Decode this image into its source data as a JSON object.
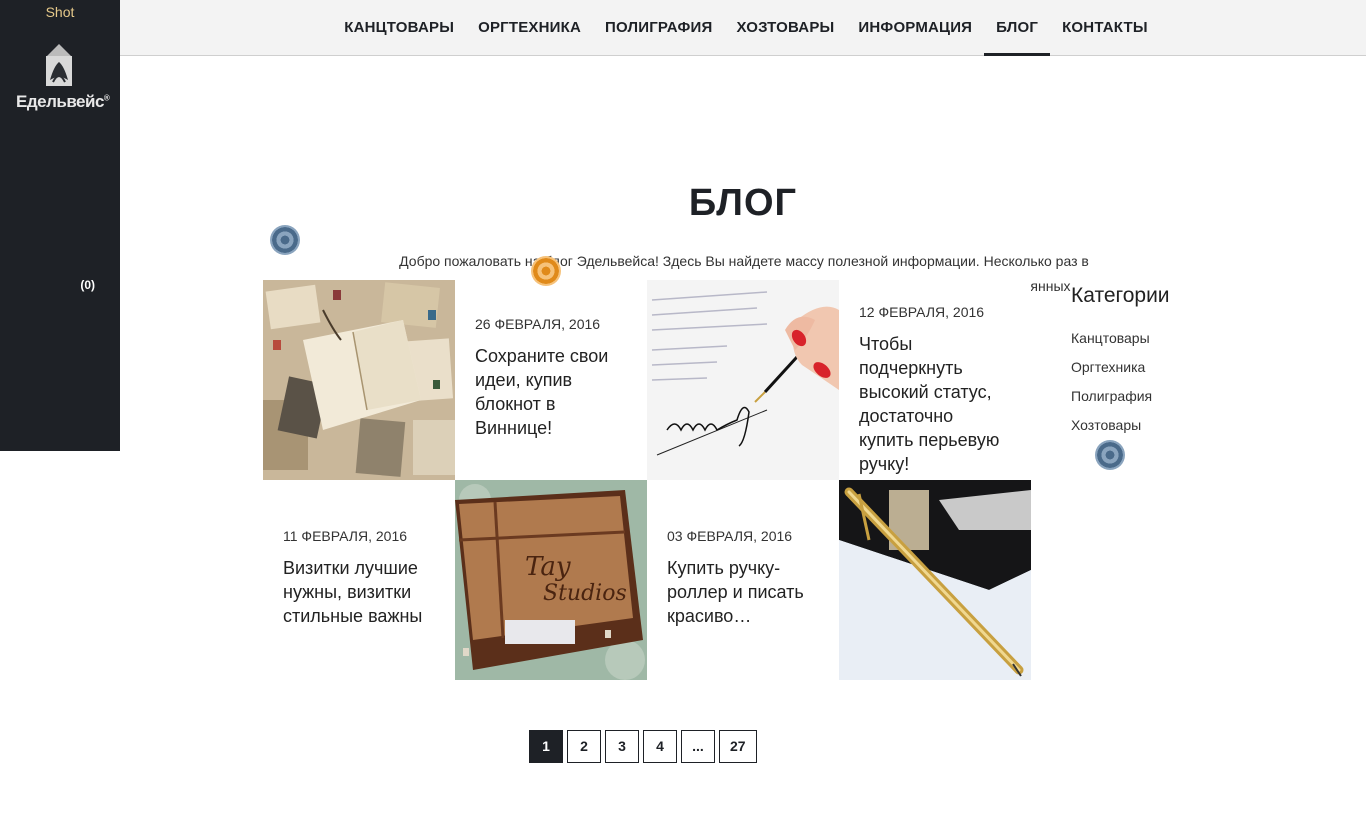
{
  "sidebar": {
    "shot_label": "Shot",
    "logo_text": "Едельвейс",
    "cart_count": "(0)"
  },
  "nav": {
    "items": [
      "КАНЦТОВАРЫ",
      "ОРГТЕХНИКА",
      "ПОЛИГРАФИЯ",
      "ХОЗТОВАРЫ",
      "ИНФОРМАЦИЯ",
      "БЛОГ",
      "КОНТАКТЫ"
    ],
    "active": "БЛОГ"
  },
  "page": {
    "title": "БЛОГ",
    "intro": "Добро пожаловать на блог Эдельвейса! Здесь Вы найдете массу полезной информации. Несколько раз в неделю наш блог пополняется свежими статьями. Будем рады Вас видеть среди наших постоянных читателей!"
  },
  "posts": [
    {
      "date": "26 ФЕВРАЛЯ, 2016",
      "title": "Сохраните свои идеи, купив блокнот в Виннице!",
      "image": "vintage-postcards-notebook"
    },
    {
      "date": "12 ФЕВРАЛЯ, 2016",
      "title": "Чтобы подчеркнуть высокий статус, достаточно купить перьевую ручку!",
      "image": "hand-signing-with-fountain-pen"
    },
    {
      "date": "11 ФЕВРАЛЯ, 2016",
      "title": "Визитки лучшие нужны, визитки стильные важны",
      "image": "wooden-business-card-box"
    },
    {
      "date": "03 ФЕВРАЛЯ, 2016",
      "title": "Купить ручку-роллер и писать красиво…",
      "image": "gold-parker-pen"
    }
  ],
  "categories": {
    "heading": "Категории",
    "items": [
      "Канцтовары",
      "Оргтехника",
      "Полиграфия",
      "Хозтовары"
    ]
  },
  "pagination": {
    "pages": [
      "1",
      "2",
      "3",
      "4",
      "...",
      "27"
    ],
    "current": "1"
  },
  "colors": {
    "dark": "#1e2126",
    "nav_bg": "#f3f3f3",
    "accent_gold": "#e6c98a"
  }
}
